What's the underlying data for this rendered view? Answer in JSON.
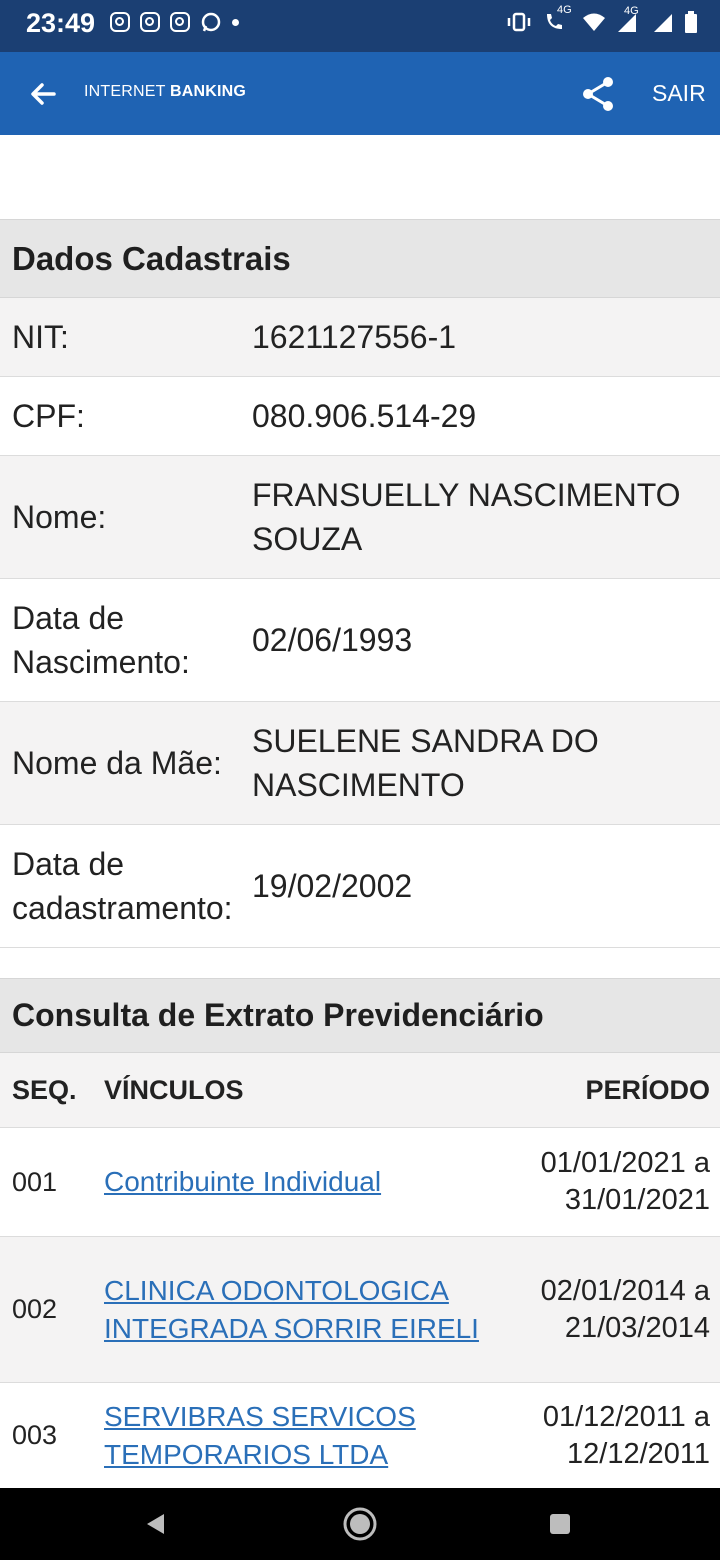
{
  "status_bar": {
    "time": "23:49",
    "network_label_1": "4G",
    "network_label_2": "4G"
  },
  "app_bar": {
    "brand_part1": "INTERNET",
    "brand_part2": "BANKING",
    "logout_label": "SAIR"
  },
  "dados": {
    "title": "Dados Cadastrais",
    "rows": [
      {
        "label": "NIT:",
        "value": "1621127556-1"
      },
      {
        "label": "CPF:",
        "value": "080.906.514-29"
      },
      {
        "label": "Nome:",
        "value": "FRANSUELLY NASCIMENTO SOUZA"
      },
      {
        "label": "Data de Nascimento:",
        "value": "02/06/1993"
      },
      {
        "label": "Nome da Mãe:",
        "value": "SUELENE SANDRA DO NASCIMENTO"
      },
      {
        "label": "Data de cadastramento:",
        "value": "19/02/2002"
      }
    ]
  },
  "extrato": {
    "title": "Consulta de Extrato Previdenciário",
    "headers": {
      "seq": "SEQ.",
      "vinculos": "VÍNCULOS",
      "periodo": "PERÍODO"
    },
    "rows": [
      {
        "seq": "001",
        "vinculo": "Contribuinte Individual",
        "periodo": "01/01/2021 a 31/01/2021"
      },
      {
        "seq": "002",
        "vinculo": "CLINICA ODONTOLOGICA INTEGRADA SORRIR EIRELI",
        "periodo": "02/01/2014 a 21/03/2014"
      },
      {
        "seq": "003",
        "vinculo": "SERVIBRAS SERVICOS TEMPORARIOS LTDA",
        "periodo": "01/12/2011 a 12/12/2011"
      }
    ]
  },
  "colors": {
    "status_bar": "#1b3f73",
    "app_bar": "#1f63b3",
    "link": "#2a6fb8",
    "section_header_bg": "#e6e6e6"
  },
  "icons": [
    "instagram-icon",
    "whatsapp-icon",
    "vibrate-icon",
    "volte-call-icon",
    "wifi-icon",
    "signal-icon",
    "battery-icon",
    "back-arrow-icon",
    "share-icon",
    "nav-back-icon",
    "nav-home-icon",
    "nav-recents-icon"
  ]
}
